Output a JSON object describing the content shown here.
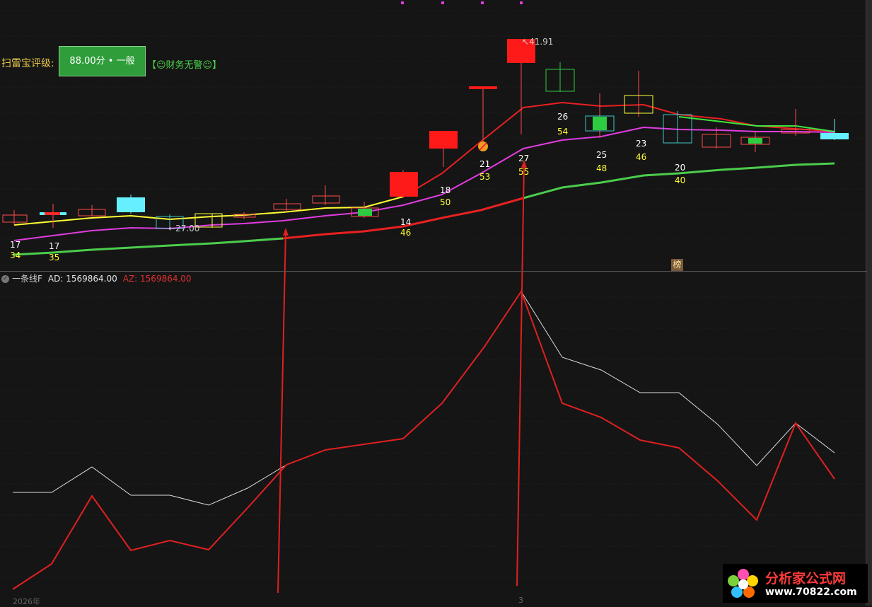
{
  "rating": {
    "prefix": "扫雷宝评级:",
    "score": "88.00分 • 一般",
    "finance": "【☺财务无警☺】"
  },
  "indicator": {
    "name": "一条线F",
    "ad": "AD: 1569864.00",
    "az": "AZ: 1569864.00"
  },
  "price_labels": {
    "high": "41.91",
    "low": "27.00"
  },
  "bang": "榜",
  "year_label": "2026年",
  "x_tick": "3",
  "logo": {
    "title": "分析家公式网",
    "url": "www.70822.com"
  },
  "number_pairs": [
    {
      "top": "17",
      "bottom": "34"
    },
    {
      "top": "17",
      "bottom": "35"
    },
    {
      "top": "14",
      "bottom": "46"
    },
    {
      "top": "18",
      "bottom": "50"
    },
    {
      "top": "21",
      "bottom": "53"
    },
    {
      "top": "27",
      "bottom": "55"
    },
    {
      "top": "26",
      "bottom": "54"
    },
    {
      "top": "25",
      "bottom": "48"
    },
    {
      "top": "23",
      "bottom": "46"
    },
    {
      "top": "20",
      "bottom": "40"
    }
  ],
  "colors": {
    "up": "#ff2a2a",
    "down_green": "#2ecc40",
    "cyan": "#66f0ff",
    "yellow_line": "#ffff33",
    "magenta_line": "#e03ce0",
    "green_line": "#4ccc4c",
    "red_line": "#e02020",
    "white_line": "#dddddd"
  }
}
